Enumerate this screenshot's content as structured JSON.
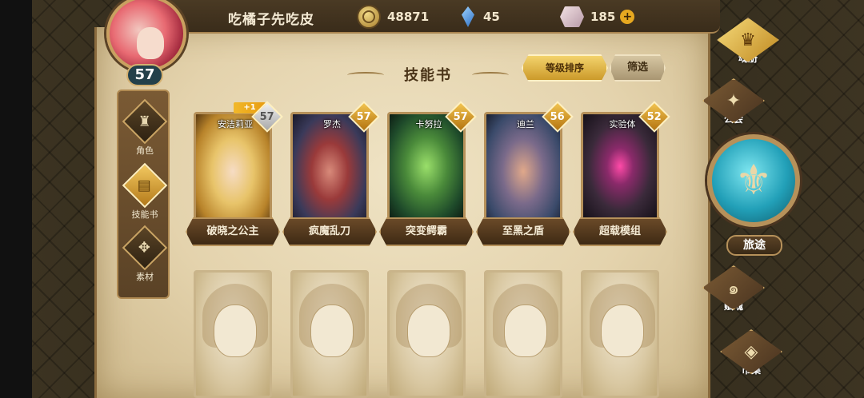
{
  "player": {
    "name": "吃橘子先吃皮",
    "level": "57"
  },
  "currencies": [
    {
      "icon": "gold-coin-icon",
      "value": "48871"
    },
    {
      "icon": "blue-crystal-icon",
      "value": "45"
    },
    {
      "icon": "pink-stone-icon",
      "value": "185",
      "add_label": "+"
    }
  ],
  "left_nav": [
    {
      "label": "角色",
      "icon": "helmet-icon",
      "active": false
    },
    {
      "label": "技能书",
      "icon": "book-icon",
      "active": true
    },
    {
      "label": "素材",
      "icon": "beast-icon",
      "active": false
    }
  ],
  "page": {
    "title": "技能书",
    "sort_label": "等级排序",
    "filter_label": "筛选"
  },
  "cards": [
    {
      "name": "安洁莉亚",
      "level": "57",
      "level_style": "silver",
      "plus": "+1",
      "skill": "破晓之公主"
    },
    {
      "name": "罗杰",
      "level": "57",
      "level_style": "gold",
      "skill": "疯魔乱刀"
    },
    {
      "name": "卡努拉",
      "level": "57",
      "level_style": "gold",
      "skill": "突变鳄霸"
    },
    {
      "name": "迪兰",
      "level": "56",
      "level_style": "gold",
      "skill": "至黑之盾"
    },
    {
      "name": "实验体",
      "level": "52",
      "level_style": "gold",
      "skill": "超载模组"
    }
  ],
  "locked_cards_count": 5,
  "right_menu": [
    {
      "label": "魂册",
      "icon": "soul-book-icon",
      "active": true
    },
    {
      "label": "公会",
      "icon": "guild-icon",
      "active": false
    },
    {
      "label": "旅途",
      "icon": "journey-emblem-icon",
      "active": false
    },
    {
      "label": "赋魂",
      "icon": "swirl-icon",
      "active": false
    },
    {
      "label": "市集",
      "icon": "market-icon",
      "active": false
    }
  ],
  "colors": {
    "accent_gold": "#f2c450",
    "parchment": "#e4d3ad",
    "frame_brown": "#5a4226",
    "journey_teal": "#22a0b8"
  }
}
